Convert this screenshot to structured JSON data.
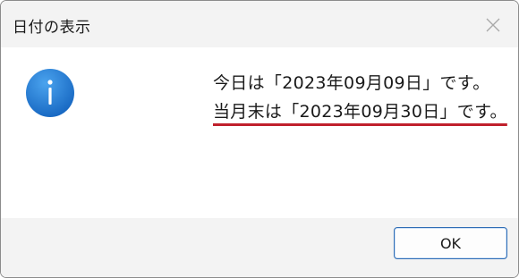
{
  "window": {
    "title": "日付の表示"
  },
  "dialog": {
    "icon": "info-icon",
    "message_line1": "今日は「2023年09月09日」です。",
    "message_line2": "当月末は「2023年09月30日」です。"
  },
  "buttons": {
    "ok_label": "OK"
  },
  "colors": {
    "titlebar_bg": "#f3f3f3",
    "info_icon_blue": "#1e7fd6",
    "underline_red": "#c0202c",
    "ok_border": "#2f6db5"
  }
}
